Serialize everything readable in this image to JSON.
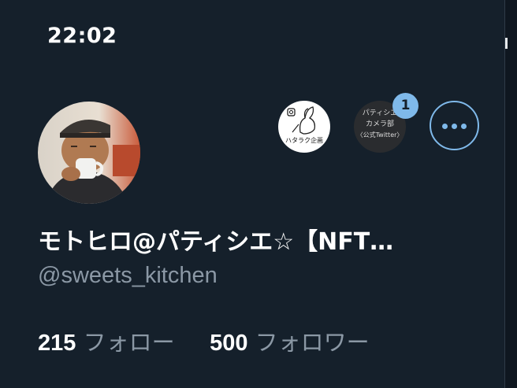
{
  "status_bar": {
    "time": "22:02"
  },
  "profile": {
    "display_name": "モトヒロ@パティシエ☆【NFT…",
    "handle": "@sweets_kitchen",
    "following_count": "215",
    "following_label": "フォロー",
    "followers_count": "500",
    "followers_label": "フォロワー"
  },
  "header_chips": [
    {
      "label": "ハタラク企画"
    },
    {
      "label_lines": [
        "パティシエ",
        "カメラ部",
        "〈公式Twitter〉"
      ],
      "badge": "1"
    }
  ],
  "colors": {
    "background": "#15202b",
    "accent": "#7fb9ea",
    "secondary_text": "#8b98a5"
  },
  "icons": [
    "more-icon",
    "instagram-icon",
    "rabbit-illustration"
  ]
}
